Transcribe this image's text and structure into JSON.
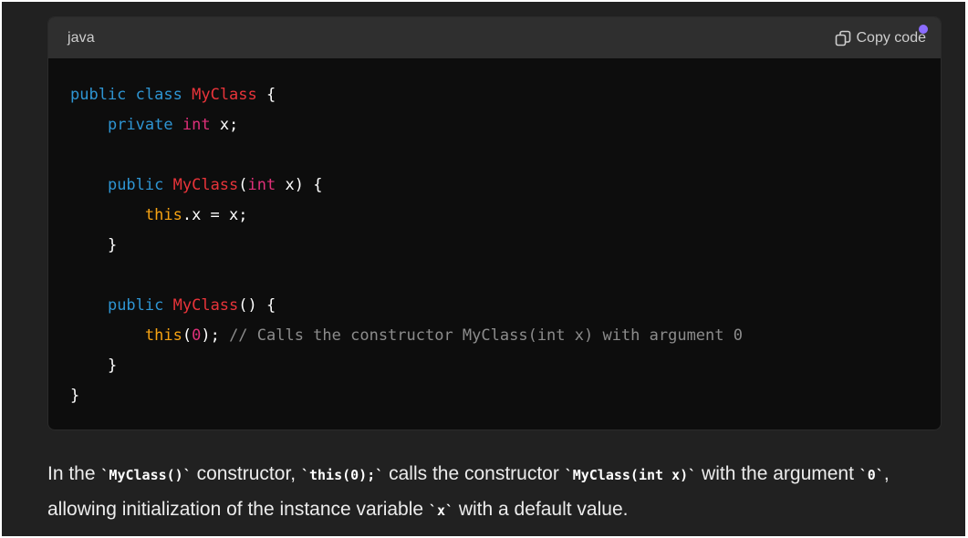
{
  "code_block": {
    "language": "java",
    "copy_label": "Copy code",
    "copy_icon": "copy-icon",
    "lines": [
      [
        {
          "t": "public",
          "c": "keyword"
        },
        {
          "t": " ",
          "c": "plain"
        },
        {
          "t": "class",
          "c": "keyword"
        },
        {
          "t": " ",
          "c": "plain"
        },
        {
          "t": "MyClass",
          "c": "class"
        },
        {
          "t": " {",
          "c": "plain"
        }
      ],
      [
        {
          "t": "    ",
          "c": "plain"
        },
        {
          "t": "private",
          "c": "keyword"
        },
        {
          "t": " ",
          "c": "plain"
        },
        {
          "t": "int",
          "c": "type"
        },
        {
          "t": " x;",
          "c": "plain"
        }
      ],
      [],
      [
        {
          "t": "    ",
          "c": "plain"
        },
        {
          "t": "public",
          "c": "keyword"
        },
        {
          "t": " ",
          "c": "plain"
        },
        {
          "t": "MyClass",
          "c": "class"
        },
        {
          "t": "(",
          "c": "plain"
        },
        {
          "t": "int",
          "c": "type"
        },
        {
          "t": " x) {",
          "c": "plain"
        }
      ],
      [
        {
          "t": "        ",
          "c": "plain"
        },
        {
          "t": "this",
          "c": "this"
        },
        {
          "t": ".x = x;",
          "c": "plain"
        }
      ],
      [
        {
          "t": "    }",
          "c": "plain"
        }
      ],
      [],
      [
        {
          "t": "    ",
          "c": "plain"
        },
        {
          "t": "public",
          "c": "keyword"
        },
        {
          "t": " ",
          "c": "plain"
        },
        {
          "t": "MyClass",
          "c": "class"
        },
        {
          "t": "() {",
          "c": "plain"
        }
      ],
      [
        {
          "t": "        ",
          "c": "plain"
        },
        {
          "t": "this",
          "c": "this"
        },
        {
          "t": "(",
          "c": "plain"
        },
        {
          "t": "0",
          "c": "number"
        },
        {
          "t": "); ",
          "c": "plain"
        },
        {
          "t": "// Calls the constructor MyClass(int x) with argument 0",
          "c": "comment"
        }
      ],
      [
        {
          "t": "    }",
          "c": "plain"
        }
      ],
      [
        {
          "t": "}",
          "c": "plain"
        }
      ]
    ]
  },
  "description": {
    "segments": [
      {
        "t": "In the ",
        "code": false
      },
      {
        "t": "`MyClass()`",
        "code": true
      },
      {
        "t": " constructor, ",
        "code": false
      },
      {
        "t": "`this(0);`",
        "code": true
      },
      {
        "t": " calls the constructor ",
        "code": false
      },
      {
        "t": "`MyClass(int x)`",
        "code": true
      },
      {
        "t": " with the argument ",
        "code": false
      },
      {
        "t": "`0`",
        "code": true
      },
      {
        "t": ", allowing initialization of the instance variable ",
        "code": false
      },
      {
        "t": "`x`",
        "code": true
      },
      {
        "t": " with a default value.",
        "code": false
      }
    ]
  },
  "colors": {
    "background": "#212121",
    "code_background": "#0d0d0d",
    "code_header": "#2f2f2f",
    "keyword": "#2e95d3",
    "type": "#df3079",
    "class_name": "#e9343a",
    "this": "#f6a313",
    "comment": "#8c8c8c",
    "cursor_dot": "#8b6cff"
  }
}
